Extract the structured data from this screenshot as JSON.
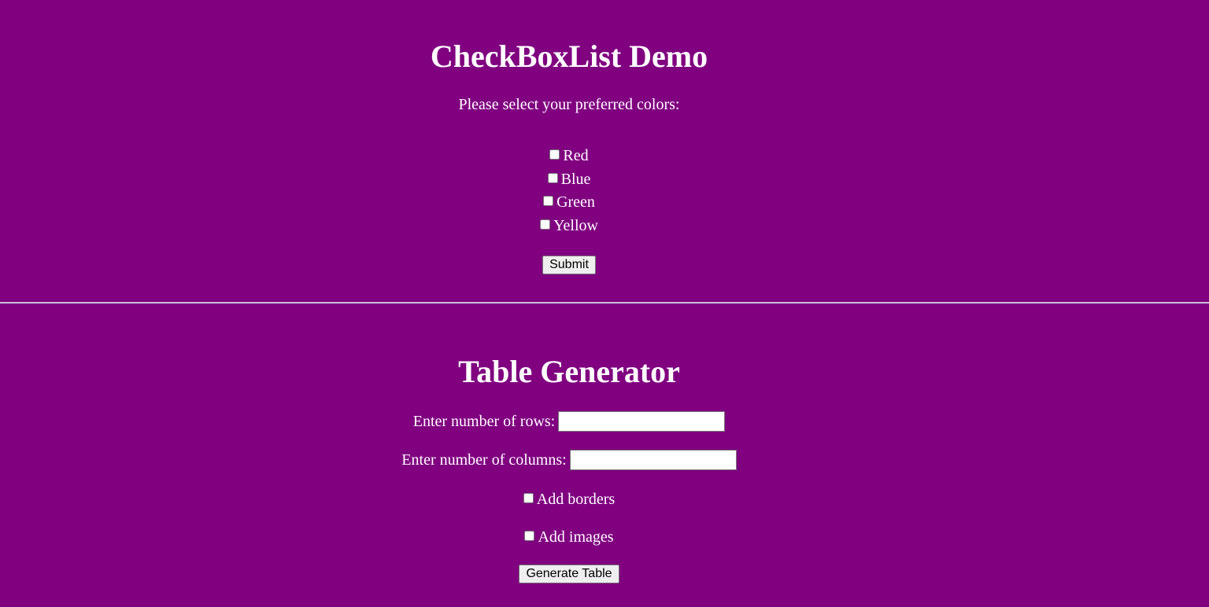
{
  "checkbox_section": {
    "title": "CheckBoxList Demo",
    "prompt": "Please select your preferred colors:",
    "options": [
      {
        "label": "Red",
        "checked": false
      },
      {
        "label": "Blue",
        "checked": false
      },
      {
        "label": "Green",
        "checked": false
      },
      {
        "label": "Yellow",
        "checked": false
      }
    ],
    "submit_label": "Submit"
  },
  "table_section": {
    "title": "Table Generator",
    "rows_label": "Enter number of rows:",
    "rows_value": "",
    "columns_label": "Enter number of columns:",
    "columns_value": "",
    "borders_label": "Add borders",
    "borders_checked": false,
    "images_label": "Add images",
    "images_checked": false,
    "generate_label": "Generate Table"
  },
  "colors": {
    "background": "#800080",
    "text": "#ffffff",
    "divider": "#c9c2d6"
  }
}
